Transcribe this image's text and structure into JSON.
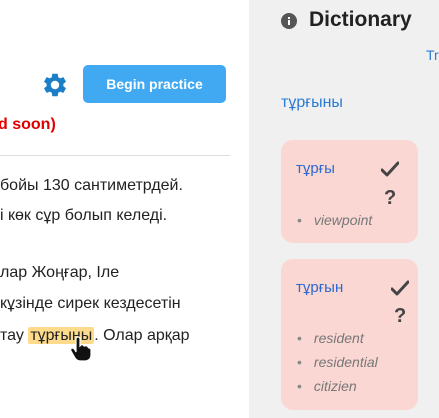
{
  "toolbar": {
    "settings_icon": "gear-icon",
    "begin_label": "Begin practice",
    "accent_color": "#40a9f1"
  },
  "notice": {
    "text": "d soon)",
    "color": "#e00000"
  },
  "passage": {
    "lines": [
      "бойы 130 сантиметрдей.",
      "і көк сұр болып келеді.",
      "лар Жоңғар, Іле",
      "кұзінде сирек кездесетін",
      "тау",
      "тұрғыны",
      ". Олар арқар"
    ],
    "highlighted_word": "тұрғыны",
    "highlight_color": "#fddb8a"
  },
  "dictionary": {
    "title": "Dictionary",
    "tr_label": "Tr",
    "searched_word": "тұрғыны",
    "card_color": "#fad7d3",
    "entries": [
      {
        "word": "тұрғы",
        "definitions": [
          "viewpoint"
        ]
      },
      {
        "word": "тұрғын",
        "definitions": [
          "resident",
          "residential",
          "citizien"
        ]
      }
    ]
  }
}
